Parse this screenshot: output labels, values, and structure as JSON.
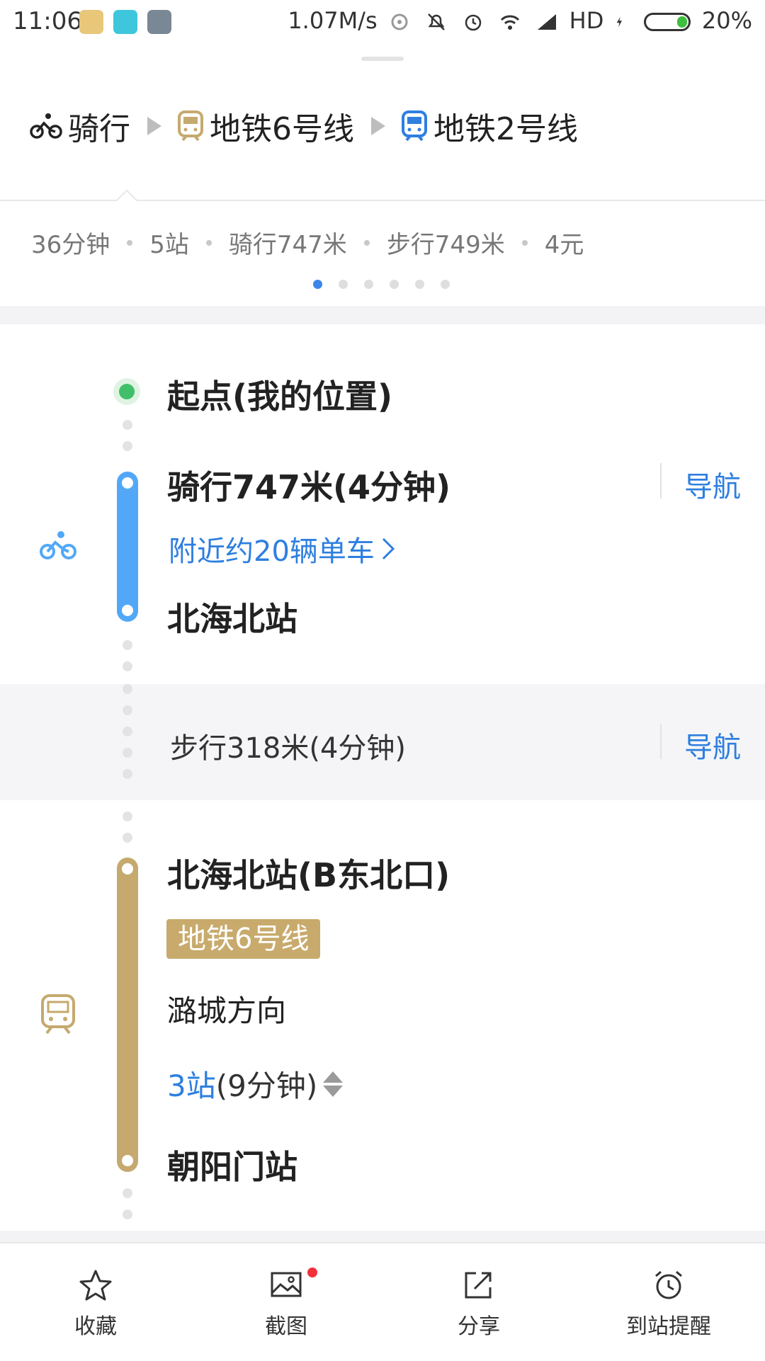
{
  "status_bar": {
    "time": "11:06",
    "network_speed": "1.07M/s",
    "hd": "HD",
    "battery": "20%",
    "icons": [
      "map-app-icon",
      "chat-app-icon",
      "note-app-icon",
      "hotspot-icon",
      "mute-icon",
      "alarm-icon",
      "wifi-icon",
      "signal-icon",
      "charging-icon",
      "battery-icon"
    ]
  },
  "route_header": {
    "segments": [
      {
        "icon": "bike-icon",
        "label": "骑行"
      },
      {
        "icon": "subway-icon",
        "label": "地铁6号线",
        "color": "#c5a96e"
      },
      {
        "icon": "subway-icon",
        "label": "地铁2号线",
        "color": "#2e7fe0"
      }
    ]
  },
  "summary": {
    "duration": "36分钟",
    "stations": "5站",
    "ride": "骑行747米",
    "walk": "步行749米",
    "price": "4元"
  },
  "pager": {
    "total": 6,
    "active": 1
  },
  "timeline": {
    "start": {
      "label": "起点(我的位置)"
    },
    "bike_step": {
      "title": "骑行747米(4分钟)",
      "nav_label": "导航",
      "bikes_nearby": "附近约20辆单车",
      "end_station": "北海北站",
      "color": "#52a8f7"
    },
    "walk_step": {
      "text": "步行318米(4分钟)",
      "nav_label": "导航"
    },
    "metro_step": {
      "entrance": "北海北站(B东北口)",
      "line": "地铁6号线",
      "direction": "潞城方向",
      "stops_count": "3站",
      "stops_time": "(9分钟)",
      "end_station": "朝阳门站",
      "color": "#c5a96e"
    }
  },
  "bottom_bar": {
    "favorite": "收藏",
    "screenshot": "截图",
    "share": "分享",
    "arrival_alert": "到站提醒"
  },
  "colors": {
    "accent": "#2e7fe0",
    "line6": "#c5a96e",
    "bike": "#52a8f7",
    "start": "#3fbf6a",
    "notification": "#f2303a"
  }
}
